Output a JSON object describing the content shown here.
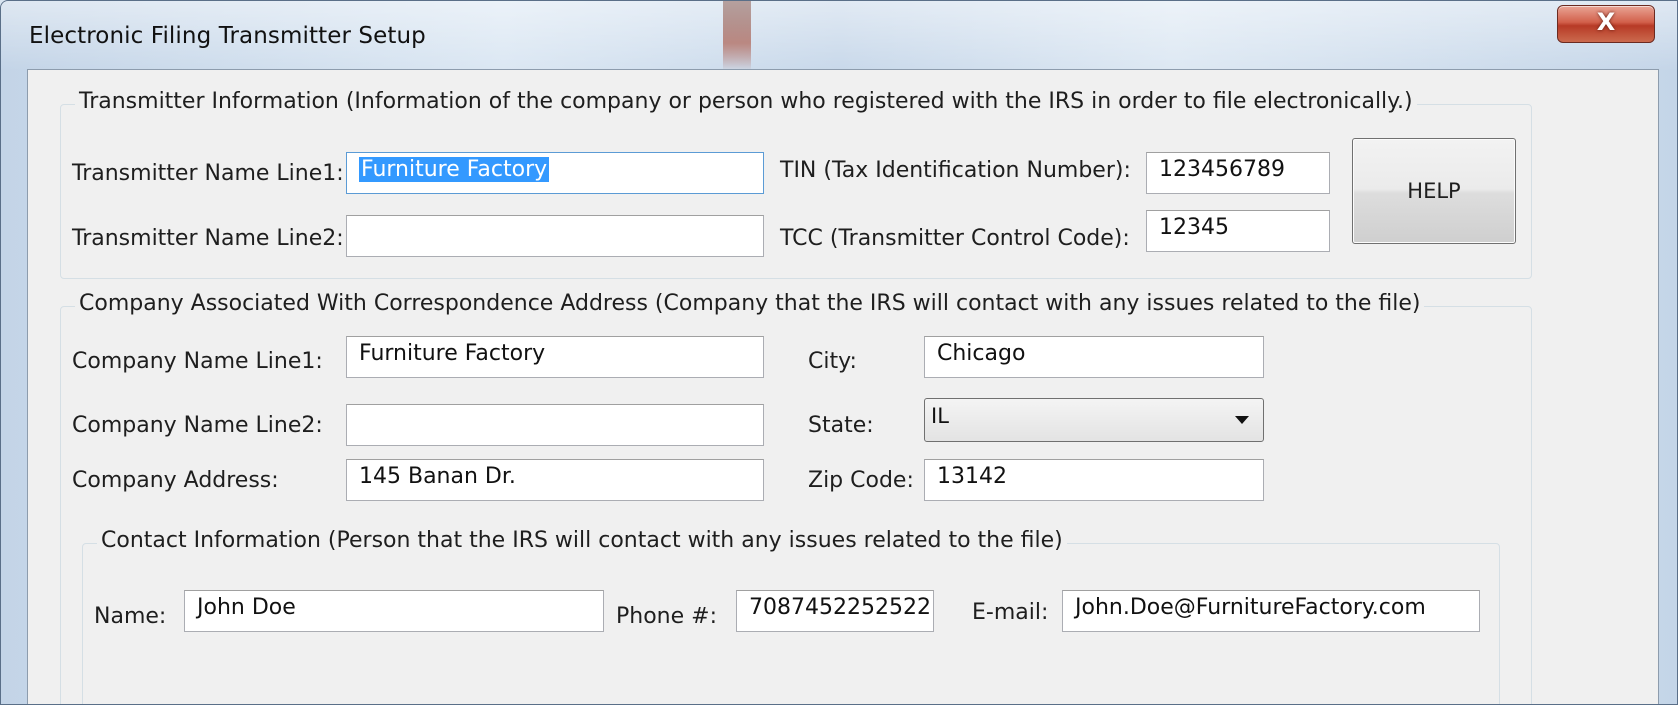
{
  "window": {
    "title": "Electronic Filing Transmitter Setup",
    "close_glyph": "X"
  },
  "transmitter": {
    "legend": "Transmitter Information (Information of the company or person who registered with the IRS in order to file electronically.)",
    "name_line1_label": "Transmitter Name Line1:",
    "name_line1_value": "Furniture Factory",
    "name_line2_label": "Transmitter Name Line2:",
    "name_line2_value": "",
    "tin_label": "TIN (Tax Identification Number):",
    "tin_value": "123456789",
    "tcc_label": "TCC (Transmitter Control Code):",
    "tcc_value": "12345",
    "help_label": "HELP"
  },
  "company": {
    "legend": "Company Associated With Correspondence Address (Company that the IRS will contact with any issues related to the file)",
    "name_line1_label": "Company Name Line1:",
    "name_line1_value": "Furniture Factory",
    "name_line2_label": "Company Name Line2:",
    "name_line2_value": "",
    "address_label": "Company Address:",
    "address_value": "145 Banan Dr.",
    "city_label": "City:",
    "city_value": "Chicago",
    "state_label": "State:",
    "state_value": "IL",
    "zip_label": "Zip Code:",
    "zip_value": "13142"
  },
  "contact": {
    "legend": "Contact Information (Person that the IRS will contact with any issues related to the file)",
    "name_label": "Name:",
    "name_value": "John Doe",
    "phone_label": "Phone #:",
    "phone_value": "7087452252522",
    "email_label": "E-mail:",
    "email_value": "John.Doe@FurnitureFactory.com"
  }
}
